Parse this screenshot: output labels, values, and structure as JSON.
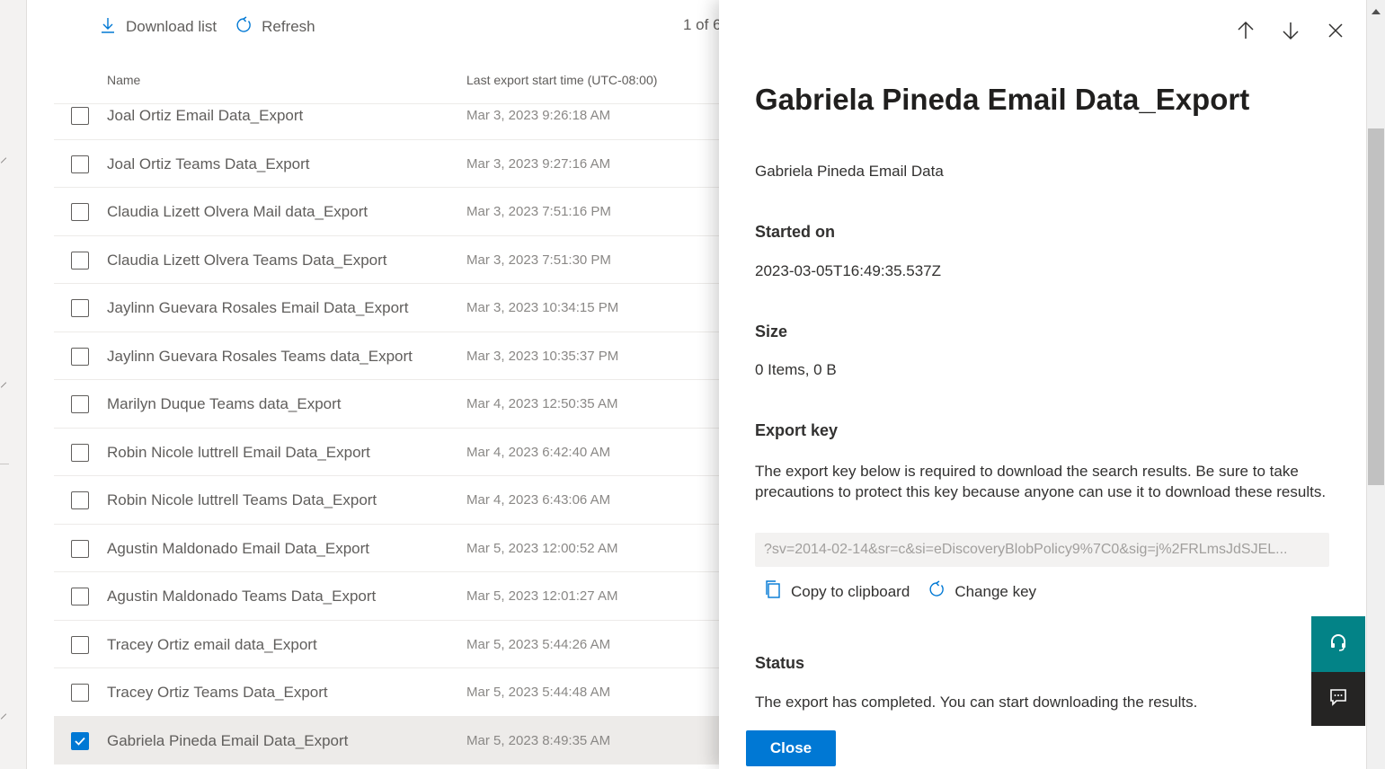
{
  "toolbar": {
    "download_label": "Download list",
    "refresh_label": "Refresh",
    "pager_text": "1 of 6"
  },
  "table": {
    "col_name": "Name",
    "col_time": "Last export start time (UTC-08:00)",
    "rows": [
      {
        "name": "Joal Ortiz Email Data_Export",
        "time": "Mar 3, 2023 9:26:18 AM",
        "checked": false
      },
      {
        "name": "Joal Ortiz Teams Data_Export",
        "time": "Mar 3, 2023 9:27:16 AM",
        "checked": false
      },
      {
        "name": "Claudia Lizett Olvera Mail data_Export",
        "time": "Mar 3, 2023 7:51:16 PM",
        "checked": false
      },
      {
        "name": "Claudia Lizett Olvera Teams Data_Export",
        "time": "Mar 3, 2023 7:51:30 PM",
        "checked": false
      },
      {
        "name": "Jaylinn Guevara Rosales Email Data_Export",
        "time": "Mar 3, 2023 10:34:15 PM",
        "checked": false
      },
      {
        "name": "Jaylinn Guevara Rosales Teams data_Export",
        "time": "Mar 3, 2023 10:35:37 PM",
        "checked": false
      },
      {
        "name": "Marilyn Duque Teams data_Export",
        "time": "Mar 4, 2023 12:50:35 AM",
        "checked": false
      },
      {
        "name": "Robin Nicole luttrell Email Data_Export",
        "time": "Mar 4, 2023 6:42:40 AM",
        "checked": false
      },
      {
        "name": "Robin Nicole luttrell Teams Data_Export",
        "time": "Mar 4, 2023 6:43:06 AM",
        "checked": false
      },
      {
        "name": "Agustin Maldonado Email Data_Export",
        "time": "Mar 5, 2023 12:00:52 AM",
        "checked": false
      },
      {
        "name": "Agustin Maldonado Teams Data_Export",
        "time": "Mar 5, 2023 12:01:27 AM",
        "checked": false
      },
      {
        "name": "Tracey Ortiz email data_Export",
        "time": "Mar 5, 2023 5:44:26 AM",
        "checked": false
      },
      {
        "name": "Tracey Ortiz Teams Data_Export",
        "time": "Mar 5, 2023 5:44:48 AM",
        "checked": false
      },
      {
        "name": "Gabriela Pineda Email Data_Export",
        "time": "Mar 5, 2023 8:49:35 AM",
        "checked": true
      }
    ]
  },
  "panel": {
    "title": "Gabriela Pineda Email Data_Export",
    "description": "Gabriela Pineda Email Data",
    "started_label": "Started on",
    "started_value": "2023-03-05T16:49:35.537Z",
    "size_label": "Size",
    "size_value": "0 Items, 0 B",
    "export_key_label": "Export key",
    "export_key_note": "The export key below is required to download the search results. Be sure to take precautions to protect this key because anyone can use it to download these results.",
    "export_key_value": "?sv=2014-02-14&sr=c&si=eDiscoveryBlobPolicy9%7C0&sig=j%2FRLmsJdSJEL...",
    "copy_label": "Copy to clipboard",
    "change_key_label": "Change key",
    "status_label": "Status",
    "status_value": "The export has completed. You can start downloading the results.",
    "close_label": "Close"
  },
  "colors": {
    "accent": "#0078d4",
    "help_fab": "#038387",
    "feedback_fab": "#252423"
  },
  "icons": {
    "download": "download-icon",
    "refresh": "refresh-icon",
    "up": "arrow-up-icon",
    "down": "arrow-down-icon",
    "close": "close-icon",
    "copy": "copy-icon",
    "change_key": "refresh-icon",
    "help": "headset-icon",
    "feedback": "feedback-icon"
  }
}
